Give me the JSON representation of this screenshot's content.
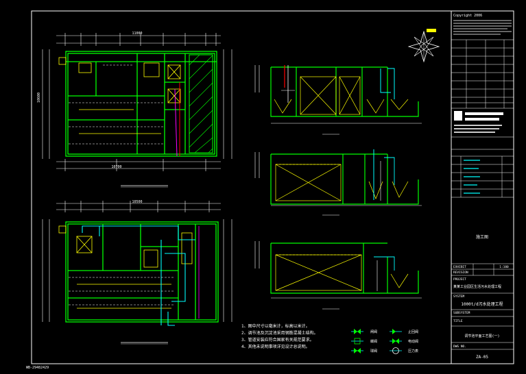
{
  "titleblock": {
    "copyright": "Copyright 2006",
    "stage": "施工图",
    "line1_left": "EXHIBIT",
    "line1_scale": "1:100",
    "line2_left": "REVISION",
    "project_header": "PROJECT",
    "project_name": "某某工业园区生活污水处理工程",
    "system_header": "SYSTEM",
    "system_name": "1000t/d污水处理工程",
    "subsystem_header": "SUBSYSTEM",
    "title_header": "TITLE",
    "title_name": "调节池平面工艺图(一)",
    "drawing_no_label": "DWG NO.",
    "drawing_no": "ZA-05"
  },
  "notes": {
    "items": [
      "1、图中尺寸以毫米计，标高以米计。",
      "2、调节池及沉淀池采用钢筋混凝土结构。",
      "3、管道安装应符合国家有关规范要求。",
      "4、其他未说明事项详见设计总说明。"
    ]
  },
  "legend": {
    "items": [
      "闸阀",
      "止回阀",
      "蝶阀",
      "电动阀",
      "球阀",
      "压力表"
    ]
  },
  "dims": {
    "top_total": "11000",
    "top_total_bottom": "10700",
    "plan_width": "10500",
    "left_total": "10600"
  },
  "status_text": "WB-29482429",
  "colors": {
    "background": "#000000",
    "frame": "#ffffff",
    "walls": "#00ff00",
    "dims": "#ffffff",
    "pipe": "#00ffff",
    "hatch": "#ffff00",
    "red": "#ff0000",
    "magenta": "#ff00ff"
  }
}
